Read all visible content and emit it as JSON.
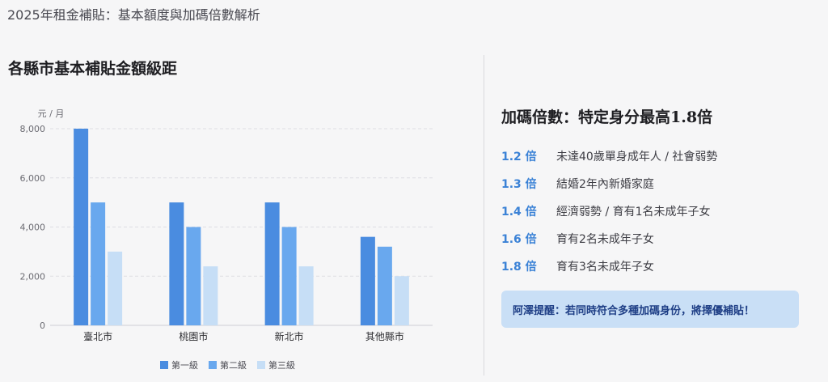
{
  "page_title": "2025年租金補貼：基本額度與加碼倍數解析",
  "left_section": {
    "heading": "各縣市基本補貼金額級距"
  },
  "chart_data": {
    "type": "bar",
    "ylabel": "元 / 月",
    "xlabel": "",
    "ylim": [
      0,
      8000
    ],
    "yticks": [
      0,
      2000,
      4000,
      6000,
      8000
    ],
    "ytick_labels": [
      "0",
      "2,000",
      "4,000",
      "6,000",
      "8,000"
    ],
    "grid": true,
    "legend_position": "bottom-center",
    "categories": [
      "臺北市",
      "桃園市",
      "新北市",
      "其他縣市"
    ],
    "series": [
      {
        "name": "第一級",
        "color": "#4a8ce0",
        "values": [
          8000,
          5000,
          5000,
          3600
        ]
      },
      {
        "name": "第二級",
        "color": "#69a8ee",
        "values": [
          5000,
          4000,
          4000,
          3200
        ]
      },
      {
        "name": "第三級",
        "color": "#c6def6",
        "values": [
          3000,
          2400,
          2400,
          2000
        ]
      }
    ]
  },
  "right_section": {
    "title": "加碼倍數：特定身分最高1.8倍",
    "multipliers": [
      {
        "value": "1.2 倍",
        "desc": "未達40歲單身成年人 / 社會弱勢"
      },
      {
        "value": "1.3 倍",
        "desc": "結婚2年內新婚家庭"
      },
      {
        "value": "1.4 倍",
        "desc": "經濟弱勢 / 育有1名未成年子女"
      },
      {
        "value": "1.6 倍",
        "desc": "育有2名未成年子女"
      },
      {
        "value": "1.8 倍",
        "desc": "育有3名未成年子女"
      }
    ],
    "tip": "阿澤提醒：若同時符合多種加碼身份，將擇優補貼！"
  }
}
